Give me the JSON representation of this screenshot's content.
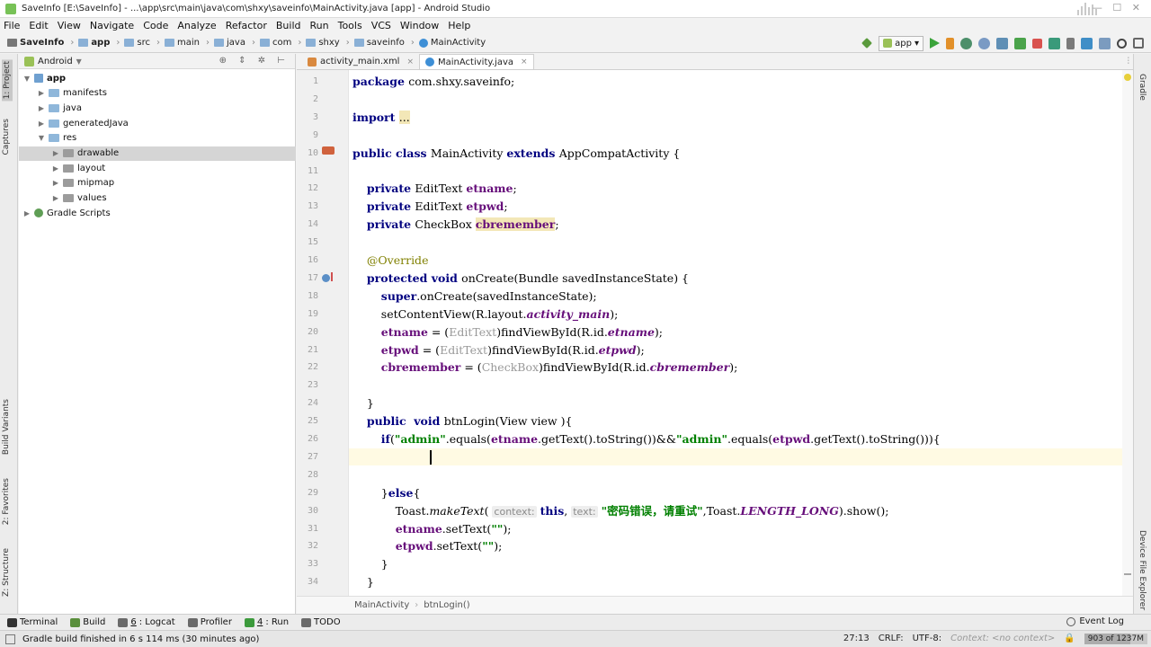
{
  "window": {
    "title": "SaveInfo [E:\\SaveInfo] - ...\\app\\src\\main\\java\\com\\shxy\\saveinfo\\MainActivity.java [app] - Android Studio"
  },
  "menu": [
    "File",
    "Edit",
    "View",
    "Navigate",
    "Code",
    "Analyze",
    "Refactor",
    "Build",
    "Run",
    "Tools",
    "VCS",
    "Window",
    "Help"
  ],
  "breadcrumbs": [
    "SaveInfo",
    "app",
    "src",
    "main",
    "java",
    "com",
    "shxy",
    "saveinfo",
    "MainActivity"
  ],
  "toolbar": {
    "run_config": "app"
  },
  "left_strip": {
    "project": "1: Project",
    "captures": "Captures",
    "build_variants": "Build Variants",
    "favorites": "2: Favorites",
    "structure": "Z: Structure"
  },
  "right_strip": {
    "gradle": "Gradle",
    "device_explorer": "Device File Explorer"
  },
  "project": {
    "view": "Android",
    "tree": [
      {
        "label": "app",
        "depth": 0,
        "expanded": true,
        "bold": true,
        "type": "module"
      },
      {
        "label": "manifests",
        "depth": 1,
        "expanded": false,
        "type": "folder"
      },
      {
        "label": "java",
        "depth": 1,
        "expanded": false,
        "type": "folder"
      },
      {
        "label": "generatedJava",
        "depth": 1,
        "expanded": false,
        "type": "folder"
      },
      {
        "label": "res",
        "depth": 1,
        "expanded": true,
        "type": "folder"
      },
      {
        "label": "drawable",
        "depth": 2,
        "expanded": false,
        "type": "resfolder",
        "selected": true
      },
      {
        "label": "layout",
        "depth": 2,
        "expanded": false,
        "type": "resfolder"
      },
      {
        "label": "mipmap",
        "depth": 2,
        "expanded": false,
        "type": "resfolder"
      },
      {
        "label": "values",
        "depth": 2,
        "expanded": false,
        "type": "resfolder"
      },
      {
        "label": "Gradle Scripts",
        "depth": 0,
        "expanded": false,
        "type": "gradle"
      }
    ]
  },
  "tabs": [
    {
      "label": "activity_main.xml",
      "active": false,
      "kind": "xml"
    },
    {
      "label": "MainActivity.java",
      "active": true,
      "kind": "class"
    }
  ],
  "editor": {
    "line_numbers": [
      "1",
      "2",
      "3",
      "9",
      "10",
      "11",
      "12",
      "13",
      "14",
      "15",
      "16",
      "17",
      "18",
      "19",
      "20",
      "21",
      "22",
      "23",
      "24",
      "25",
      "26",
      "27",
      "28",
      "29",
      "30",
      "31",
      "32",
      "33",
      "34"
    ],
    "current_line_index": 21,
    "code": [
      [
        [
          "kw",
          "package "
        ],
        [
          "",
          "com.shxy.saveinfo;"
        ]
      ],
      [],
      [
        [
          "kw",
          "import "
        ],
        [
          "hl",
          "..."
        ]
      ],
      [],
      [
        [
          "kw",
          "public class "
        ],
        [
          "",
          "MainActivity "
        ],
        [
          "kw",
          "extends "
        ],
        [
          "",
          "AppCompatActivity {"
        ]
      ],
      [],
      [
        [
          "",
          "    "
        ],
        [
          "kw",
          "private "
        ],
        [
          "",
          "EditText "
        ],
        [
          "fld",
          "etname"
        ],
        [
          "",
          ";"
        ]
      ],
      [
        [
          "",
          "    "
        ],
        [
          "kw",
          "private "
        ],
        [
          "",
          "EditText "
        ],
        [
          "fld",
          "etpwd"
        ],
        [
          "",
          ";"
        ]
      ],
      [
        [
          "",
          "    "
        ],
        [
          "kw",
          "private "
        ],
        [
          "",
          "CheckBox "
        ],
        [
          "fld hl",
          "cbremember"
        ],
        [
          "",
          ";"
        ]
      ],
      [],
      [
        [
          "",
          "    "
        ],
        [
          "ann",
          "@Override"
        ]
      ],
      [
        [
          "",
          "    "
        ],
        [
          "kw",
          "protected void "
        ],
        [
          "",
          "onCreate(Bundle savedInstanceState) {"
        ]
      ],
      [
        [
          "",
          "        "
        ],
        [
          "kw",
          "super"
        ],
        [
          "",
          ".onCreate(savedInstanceState);"
        ]
      ],
      [
        [
          "",
          "        "
        ],
        [
          "",
          "setContentView(R.layout."
        ],
        [
          "sfld",
          "activity_main"
        ],
        [
          "",
          ");"
        ]
      ],
      [
        [
          "",
          "        "
        ],
        [
          "fld",
          "etname"
        ],
        [
          "",
          " = ("
        ],
        [
          "cast",
          "EditText"
        ],
        [
          "",
          ")findViewById(R.id."
        ],
        [
          "sfld",
          "etname"
        ],
        [
          "",
          ");"
        ]
      ],
      [
        [
          "",
          "        "
        ],
        [
          "fld",
          "etpwd"
        ],
        [
          "",
          " = ("
        ],
        [
          "cast",
          "EditText"
        ],
        [
          "",
          ")findViewById(R.id."
        ],
        [
          "sfld",
          "etpwd"
        ],
        [
          "",
          ");"
        ]
      ],
      [
        [
          "",
          "        "
        ],
        [
          "fld",
          "cbremember"
        ],
        [
          "",
          " = ("
        ],
        [
          "cast",
          "CheckBox"
        ],
        [
          "",
          ")findViewById(R.id."
        ],
        [
          "sfld",
          "cbremember"
        ],
        [
          "",
          ");"
        ]
      ],
      [],
      [
        [
          "",
          "    }"
        ]
      ],
      [
        [
          "",
          "    "
        ],
        [
          "kw",
          "public  void "
        ],
        [
          "",
          "btnLogin(View view ){"
        ]
      ],
      [
        [
          "",
          "        "
        ],
        [
          "kw",
          "if"
        ],
        [
          "",
          "("
        ],
        [
          "str",
          "\"admin\""
        ],
        [
          "",
          ".equals("
        ],
        [
          "fld",
          "etname"
        ],
        [
          "",
          ".getText().toString())&&"
        ],
        [
          "str",
          "\"admin\""
        ],
        [
          "",
          ".equals("
        ],
        [
          "fld",
          "etpwd"
        ],
        [
          "",
          ".getText().toString())){"
        ]
      ],
      [],
      [],
      [
        [
          "",
          "        }"
        ],
        [
          "kw",
          "else"
        ],
        [
          "",
          "{"
        ]
      ],
      [
        [
          "",
          "            Toast."
        ],
        [
          "it",
          "makeText"
        ],
        [
          "",
          "( "
        ],
        [
          "hint",
          "context:"
        ],
        [
          "",
          " "
        ],
        [
          "kw",
          "this"
        ],
        [
          "",
          ", "
        ],
        [
          "hint",
          "text:"
        ],
        [
          "",
          " "
        ],
        [
          "str",
          "\"密码错误，请重试\""
        ],
        [
          "",
          ",Toast."
        ],
        [
          "sfld",
          "LENGTH_LONG"
        ],
        [
          "",
          ").show();"
        ]
      ],
      [
        [
          "",
          "            "
        ],
        [
          "fld",
          "etname"
        ],
        [
          "",
          ".setText("
        ],
        [
          "str",
          "\"\""
        ],
        [
          "",
          ");"
        ]
      ],
      [
        [
          "",
          "            "
        ],
        [
          "fld",
          "etpwd"
        ],
        [
          "",
          ".setText("
        ],
        [
          "str",
          "\"\""
        ],
        [
          "",
          ");"
        ]
      ],
      [
        [
          "",
          "        }"
        ]
      ],
      [
        [
          "",
          "    }"
        ]
      ]
    ]
  },
  "editor_breadcrumb": [
    "MainActivity",
    "btnLogin()"
  ],
  "bottom_tools": [
    {
      "num": "",
      "label": "Terminal",
      "icon_color": "#333333"
    },
    {
      "num": "",
      "label": "Build",
      "icon_color": "#5a8f3c"
    },
    {
      "num": "6",
      "label": ": Logcat",
      "icon_color": "#6a6a6a"
    },
    {
      "num": "",
      "label": "Profiler",
      "icon_color": "#6a6a6a"
    },
    {
      "num": "4",
      "label": ": Run",
      "icon_color": "#3c9a3c"
    },
    {
      "num": "",
      "label": "TODO",
      "icon_color": "#6a6a6a"
    }
  ],
  "event_log": "Event Log",
  "status": {
    "message": "Gradle build finished in 6 s 114 ms (30 minutes ago)",
    "position": "27:13",
    "line_sep": "CRLF:",
    "encoding": "UTF-8:",
    "context": "Context: <no context>",
    "memory": "903 of 1237M",
    "memory_fraction": 0.73
  }
}
